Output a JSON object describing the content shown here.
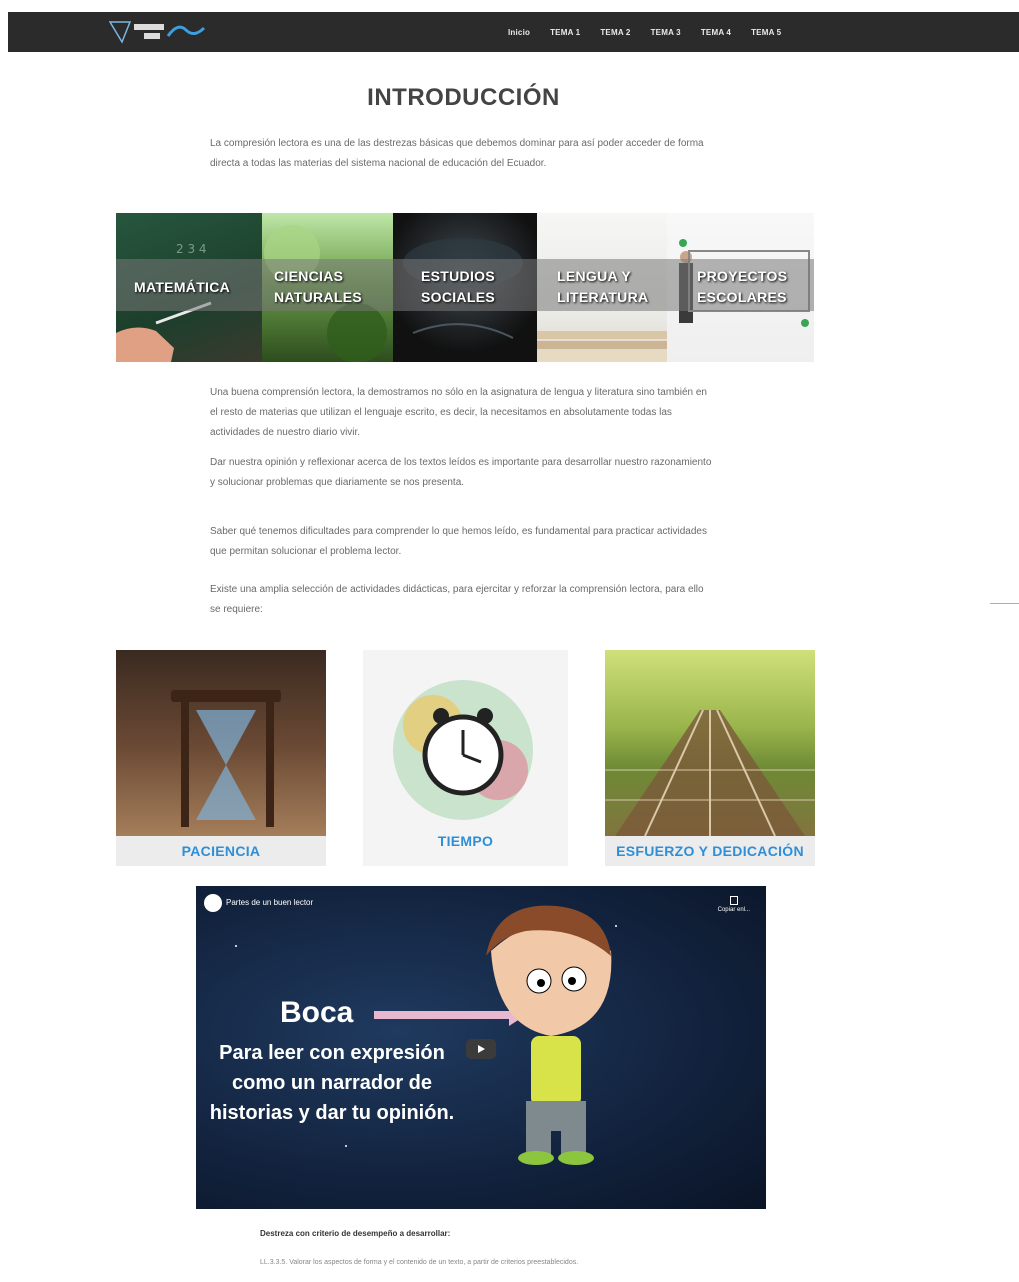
{
  "nav": {
    "items": [
      "Inicio",
      "TEMA 1",
      "TEMA 2",
      "TEMA 3",
      "TEMA 4",
      "TEMA 5"
    ]
  },
  "intro": {
    "title": "INTRODUCCIÓN",
    "paragraph": "La compresión lectora es una de las destrezas básicas que debemos dominar para así poder acceder de forma directa a todas las materias del sistema nacional de educación del Ecuador."
  },
  "subjects": [
    "MATEMÁTICA",
    "CIENCIAS NATURALES",
    "ESTUDIOS SOCIALES",
    "LENGUA Y LITERATURA",
    "PROYECTOS ESCOLARES"
  ],
  "body": {
    "p1": "Una buena comprensión lectora, la demostramos no sólo en la asignatura de lengua y literatura sino también en el resto de materias que utilizan el lenguaje escrito, es decir, la necesitamos en absolutamente todas las actividades de nuestro diario vivir.",
    "p2": "Dar nuestra opinión y reflexionar acerca de los textos leídos es importante para desarrollar nuestro razonamiento y solucionar problemas que diariamente se nos presenta.",
    "p3": "Saber qué tenemos dificultades para comprender lo que hemos leído, es fundamental para practicar actividades que permitan solucionar el problema lector.",
    "p4": "Existe una amplia selección de actividades didácticas, para ejercitar y reforzar la comprensión lectora, para ello se requiere:"
  },
  "values": [
    "PACIENCIA",
    "TIEMPO",
    "ESFUERZO Y DEDICACIÓN"
  ],
  "video": {
    "title": "Partes de un buen lector",
    "copy_label": "Copiar enl...",
    "headline": "Boca",
    "subtitle": "Para leer con expresión como un narrador de historias y dar tu opinión."
  },
  "skill": {
    "title": "Destreza con criterio de desempeño a desarrollar:",
    "text": "LL.3.3.5. Valorar los aspectos de forma y el contenido de un texto, a partir de criterios preestablecidos."
  },
  "colors": {
    "navbar": "#2b2b2b",
    "caption_blue": "#2e8fd6",
    "video_bg": "#12223d"
  }
}
